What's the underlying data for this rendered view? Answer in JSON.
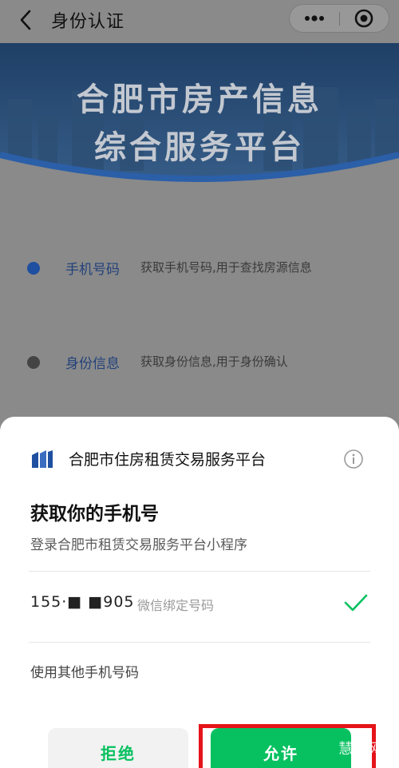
{
  "nav": {
    "title": "身份认证",
    "more_glyph": "•••"
  },
  "banner": {
    "line1": "合肥市房产信息",
    "line2": "综合服务平台"
  },
  "permissions": [
    {
      "label": "手机号码",
      "desc": "获取手机号码,用于查找房源信息",
      "dot_color": "#1f4fa0"
    },
    {
      "label": "身份信息",
      "desc": "获取身份信息,用于身份确认",
      "dot_color": "#444444"
    }
  ],
  "sheet": {
    "app_name": "合肥市住房租赁交易服务平台",
    "title": "获取你的手机号",
    "subtitle": "登录合肥市租赁交易服务平台小程序",
    "phone_number": "155·■ ■905",
    "phone_tag": "微信绑定号码",
    "other_phone": "使用其他手机号码",
    "reject_label": "拒绝",
    "allow_label": "允许"
  },
  "watermark": "慧享网",
  "colors": {
    "accent": "#07c160",
    "highlight": "#e5141b"
  }
}
